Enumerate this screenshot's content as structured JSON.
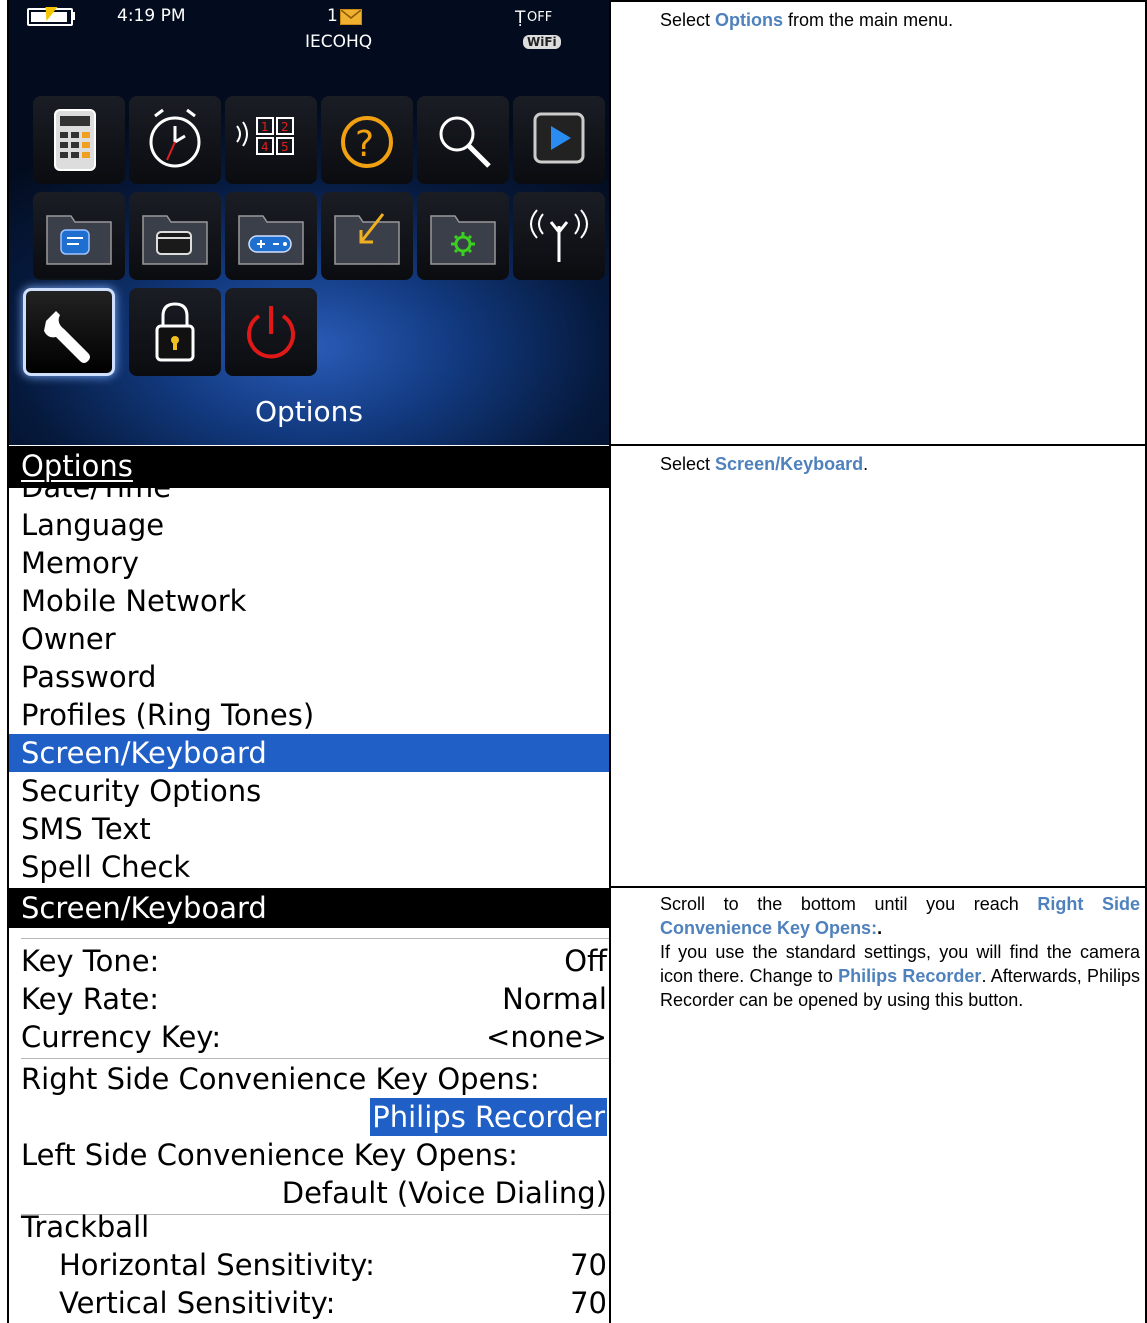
{
  "screen1": {
    "status": {
      "time": "4:19 PM",
      "messages_count": "1",
      "carrier": "IECOHQ",
      "signal_text": "OFF",
      "wifi_label": "WiFi"
    },
    "icons": [
      "calculator-icon",
      "clock-icon",
      "voice-dialing-icon",
      "help-icon",
      "search-icon",
      "media-player-icon",
      "messages-folder-icon",
      "applications-folder-icon",
      "games-folder-icon",
      "downloads-folder-icon",
      "settings-folder-icon",
      "manage-connections-icon",
      "options-wrench-icon",
      "lock-icon",
      "power-icon"
    ],
    "selected_label": "Options"
  },
  "step1": {
    "pre": "Select ",
    "highlight": "Options",
    "post": " from the main menu."
  },
  "screen2": {
    "title": "Options",
    "partial_item": "Date/Time",
    "items": [
      "Language",
      "Memory",
      "Mobile Network",
      "Owner",
      "Password",
      "Profiles (Ring Tones)",
      "Screen/Keyboard",
      "Security Options",
      "SMS Text",
      "Spell Check"
    ],
    "selected_index": 6
  },
  "step2": {
    "pre": "Select ",
    "highlight": "Screen/Keyboard",
    "post": "."
  },
  "screen3": {
    "title": "Screen/Keyboard",
    "rows": [
      {
        "label": "Key Tone:",
        "value": "Off"
      },
      {
        "label": "Key Rate:",
        "value": "Normal"
      },
      {
        "label": "Currency Key:",
        "value": "<none>"
      }
    ],
    "right_key_label": "Right Side Convenience Key Opens:",
    "right_key_value": "Philips Recorder",
    "left_key_label": "Left Side Convenience Key Opens:",
    "left_key_value": "Default (Voice Dialing)",
    "trackball_label": "Trackball",
    "trackball_rows": [
      {
        "label": "Horizontal Sensitivity:",
        "value": "70"
      },
      {
        "label": "Vertical Sensitivity:",
        "value": "70"
      }
    ]
  },
  "step3": {
    "p1_pre": "Scroll to the bottom until you reach ",
    "p1_highlight": "Right Side Convenience Key Opens:",
    "p1_post": ".",
    "p2_pre": "If you use the standard settings, you will find the camera icon there. Change to ",
    "p2_highlight": "Philips Recorder",
    "p2_post": ". Afterwards, Philips Recorder can be opened by using this button."
  }
}
